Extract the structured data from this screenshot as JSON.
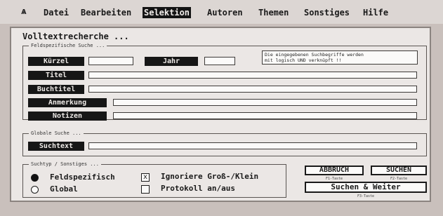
{
  "menubar": {
    "atari_symbol": "ѧ",
    "items": [
      "Datei",
      "Bearbeiten",
      "Selektion",
      "Autoren",
      "Themen",
      "Sonstiges",
      "Hilfe"
    ],
    "active": "Selektion"
  },
  "dialog": {
    "title": "Volltextrecherche ...",
    "field_group": {
      "label": "Feldspezifische Suche ...",
      "kurzel_label": "Kürzel",
      "jahr_label": "Jahr",
      "titel_label": "Titel",
      "buchtitel_label": "Buchtitel",
      "anmerkung_label": "Anmerkung",
      "notizen_label": "Notizen",
      "info_lines": [
        "Die eingegebenen Suchbegriffe werden",
        "mit logisch UND verknüpft !!"
      ]
    },
    "global_group": {
      "label": "Globale Suche ...",
      "suchtext_label": "Suchtext"
    },
    "type_group": {
      "label": "Suchtyp / Sonstiges ...",
      "option_field": "Feldspezifisch",
      "option_global": "Global",
      "checkbox_case": "Ignoriere Groß-/Klein",
      "checkbox_case_mark": "x",
      "checkbox_log": "Protokoll an/aus",
      "selected": "Feldspezifisch"
    },
    "buttons": {
      "abbruch": "ABBRUCH",
      "abbruch_hint": "F1-Taste",
      "suchen": "SUCHEN",
      "suchen_hint": "F2-Taste",
      "suchen_weiter": "Suchen & Weiter",
      "suchen_weiter_hint": "F3-Taste"
    }
  }
}
